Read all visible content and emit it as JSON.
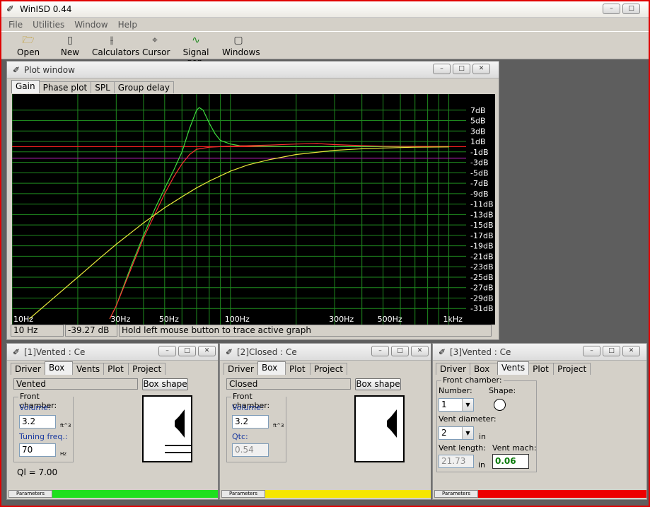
{
  "app": {
    "title": "WinISD 0.44"
  },
  "menu": [
    "File",
    "Utilities",
    "Window",
    "Help"
  ],
  "toolbar": [
    {
      "label": "Open",
      "icon": "folder-open-icon"
    },
    {
      "label": "New",
      "icon": "new-document-icon"
    },
    {
      "label": "Calculators",
      "icon": "calculator-icon"
    },
    {
      "label": "Cursor",
      "icon": "crosshair-icon"
    },
    {
      "label": "Signal gen.",
      "icon": "signal-generator-icon"
    },
    {
      "label": "Windows",
      "icon": "window-icon"
    }
  ],
  "plot_window": {
    "title": "Plot window",
    "tabs": [
      "Gain",
      "Phase plot",
      "SPL",
      "Group delay"
    ],
    "active_tab": "Gain",
    "status": {
      "freq": "10 Hz",
      "level": "-39.27 dB",
      "hint": "Hold left mouse button to trace active graph"
    }
  },
  "chart_data": {
    "type": "line",
    "x_tick_labels": [
      "10Hz",
      "30Hz",
      "50Hz",
      "100Hz",
      "300Hz",
      "500Hz",
      "1kHz"
    ],
    "x_ticks": [
      10,
      30,
      50,
      100,
      300,
      500,
      1000
    ],
    "y_tick_labels": [
      "7dB",
      "5dB",
      "3dB",
      "1dB",
      "-1dB",
      "-3dB",
      "-5dB",
      "-7dB",
      "-9dB",
      "-11dB",
      "-13dB",
      "-15dB",
      "-17dB",
      "-19dB",
      "-21dB",
      "-23dB",
      "-25dB",
      "-27dB",
      "-29dB",
      "-31dB"
    ],
    "y_ticks": [
      7,
      5,
      3,
      1,
      -1,
      -3,
      -5,
      -7,
      -9,
      -11,
      -13,
      -15,
      -17,
      -19,
      -21,
      -23,
      -25,
      -27,
      -29,
      -31
    ],
    "xlim": [
      10,
      1200
    ],
    "ylim": [
      -33,
      9
    ],
    "x_scale": "log",
    "grid": true,
    "colors": {
      "background": "#000000",
      "grid": "#1f8a1f",
      "labels": "#ffffff",
      "ref_red": "#ff2020",
      "ref_purple": "#b020b0"
    },
    "reference_lines": [
      {
        "y": 0,
        "color": "#ff2020"
      },
      {
        "y": -2.2,
        "color": "#b020b0"
      }
    ],
    "series": [
      {
        "color": "#3ddc3d",
        "x": [
          28,
          30,
          35,
          40,
          45,
          50,
          55,
          60,
          65,
          70,
          72,
          75,
          80,
          85,
          90,
          100,
          110,
          130,
          150,
          200,
          300,
          500,
          1000
        ],
        "y": [
          -33,
          -30.5,
          -23,
          -17,
          -12,
          -8,
          -4.5,
          -1,
          3.5,
          7,
          7.5,
          7,
          4.5,
          2.5,
          1.2,
          0.5,
          0.2,
          0.1,
          0.05,
          0,
          0,
          0,
          0
        ]
      },
      {
        "color": "#ff3030",
        "x": [
          28,
          30,
          35,
          40,
          45,
          50,
          55,
          60,
          65,
          70,
          80,
          90,
          100,
          150,
          200,
          250,
          300,
          400,
          500,
          1000
        ],
        "y": [
          -33,
          -30.5,
          -23.5,
          -17.5,
          -13,
          -9,
          -5.8,
          -3.3,
          -1.5,
          -0.5,
          -0.1,
          0,
          0.1,
          0.3,
          0.5,
          0.6,
          0.4,
          0.2,
          0.1,
          0
        ]
      },
      {
        "color": "#e8e83a",
        "x": [
          12,
          15,
          20,
          25,
          30,
          40,
          50,
          60,
          70,
          80,
          100,
          120,
          150,
          200,
          300,
          400,
          500,
          700,
          1000
        ],
        "y": [
          -33,
          -29.5,
          -25,
          -21.5,
          -18.7,
          -14.6,
          -11.7,
          -9.6,
          -7.9,
          -6.6,
          -4.7,
          -3.5,
          -2.5,
          -1.5,
          -0.7,
          -0.4,
          -0.25,
          -0.1,
          -0.05
        ]
      }
    ]
  },
  "windows": [
    {
      "title": "[1]Vented : Ce",
      "tabs": [
        "Driver",
        "Box",
        "Vents",
        "Plot",
        "Project"
      ],
      "active_tab": "Box",
      "box_type": "Vented",
      "box_shape_btn": "Box shape",
      "group_label": "Front chamber:",
      "volume_label": "Volume:",
      "volume": "3.2",
      "volume_unit": "ft^3",
      "second_label": "Tuning freq.:",
      "second_value": "70",
      "second_unit": "Hz",
      "extra": "Ql = 7.00",
      "params_label": "Parameters",
      "status_color": "#1ee01e"
    },
    {
      "title": "[2]Closed : Ce",
      "tabs": [
        "Driver",
        "Box",
        "Plot",
        "Project"
      ],
      "active_tab": "Box",
      "box_type": "Closed",
      "box_shape_btn": "Box shape",
      "group_label": "Front chamber:",
      "volume_label": "Volume:",
      "volume": "3.2",
      "volume_unit": "ft^3",
      "second_label": "Qtc:",
      "second_value": "0.54",
      "params_label": "Parameters",
      "status_color": "#f6e600"
    },
    {
      "title": "[3]Vented : Ce",
      "tabs": [
        "Driver",
        "Box",
        "Vents",
        "Plot",
        "Project"
      ],
      "active_tab": "Vents",
      "group_label": "Front chamber:",
      "number_label": "Number:",
      "number": "1",
      "shape_label": "Shape:",
      "diameter_label": "Vent diameter:",
      "diameter": "2",
      "diameter_unit": "in",
      "length_label": "Vent length:",
      "length": "21.73",
      "length_unit": "in",
      "mach_label": "Vent mach:",
      "mach": "0.06",
      "params_label": "Parameters",
      "status_color": "#ee0000"
    }
  ]
}
